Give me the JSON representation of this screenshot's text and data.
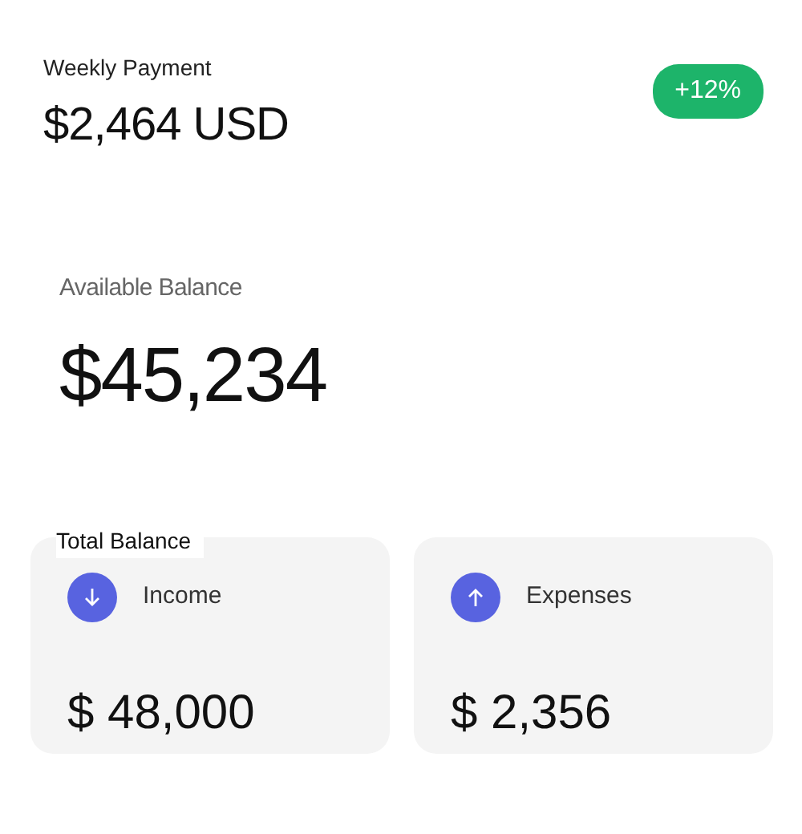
{
  "weekly_payment": {
    "label": "Weekly Payment",
    "amount": "$2,464 USD",
    "change_badge": "+12%"
  },
  "available_balance": {
    "label": "Available Balance",
    "amount": "$45,234"
  },
  "total_balance": {
    "label": "Total Balance",
    "cards": [
      {
        "kind": "income",
        "label": "Income",
        "amount": "$ 48,000"
      },
      {
        "kind": "expense",
        "label": "Expenses",
        "amount": "$ 2,356"
      }
    ]
  }
}
